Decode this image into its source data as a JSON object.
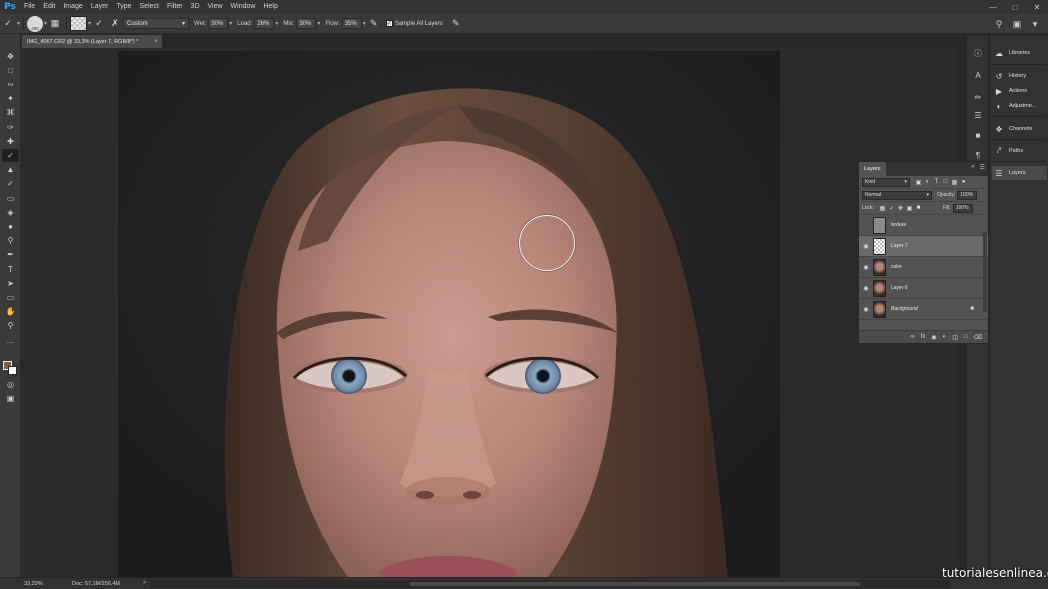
{
  "menubar": {
    "app_logo": "Ps",
    "items": [
      "File",
      "Edit",
      "Image",
      "Layer",
      "Type",
      "Select",
      "Filter",
      "3D",
      "View",
      "Window",
      "Help"
    ],
    "window_controls": [
      "minimize-icon",
      "maximize-icon",
      "close-icon"
    ]
  },
  "options": {
    "brush_size": "400",
    "preset_label": "Custom",
    "wet_label": "Wet:",
    "wet_value": "30%",
    "load_label": "Load:",
    "load_value": "26%",
    "mix_label": "Mix:",
    "mix_value": "30%",
    "flow_label": "Flow:",
    "flow_value": "35%",
    "sample_label": "Sample All Layers",
    "sample_checked": true
  },
  "document": {
    "tab_title": "IMG_4067.CR2 @ 33,3% (Layer 7, RGB/8*) *",
    "close_glyph": "×"
  },
  "tools": {
    "icons": [
      "move-tool-icon",
      "marquee-tool-icon",
      "lasso-tool-icon",
      "magic-wand-tool-icon",
      "crop-tool-icon",
      "eyedropper-tool-icon",
      "healing-brush-tool-icon",
      "mixer-brush-tool-icon",
      "clone-stamp-tool-icon",
      "history-brush-tool-icon",
      "eraser-tool-icon",
      "paint-bucket-tool-icon",
      "blur-tool-icon",
      "dodge-tool-icon",
      "pen-tool-icon",
      "type-tool-icon",
      "path-selection-tool-icon",
      "rectangle-tool-icon",
      "hand-tool-icon",
      "zoom-tool-icon",
      "more-tools-icon"
    ],
    "active": "mixer-brush-tool-icon",
    "foreground_color": "#8a5a50",
    "background_color": "#ffffff"
  },
  "dock": {
    "libraries": "Libraries",
    "history": "History",
    "actions": "Actions",
    "adjustments": "Adjustme...",
    "channels": "Channels",
    "paths": "Paths",
    "layers": "Layers"
  },
  "layers_panel": {
    "title": "Layers",
    "filter_kind": "Kind",
    "blend_mode": "Normal",
    "opacity_label": "Opacity:",
    "opacity_value": "100%",
    "lock_label": "Lock:",
    "fill_label": "Fill:",
    "fill_value": "100%",
    "layers": [
      {
        "name": "texture",
        "visible": false,
        "selected": false,
        "italic": false,
        "locked": false
      },
      {
        "name": "Layer 7",
        "visible": true,
        "selected": true,
        "italic": false,
        "locked": false
      },
      {
        "name": "color",
        "visible": true,
        "selected": false,
        "italic": false,
        "locked": false
      },
      {
        "name": "Layer 6",
        "visible": true,
        "selected": false,
        "italic": false,
        "locked": false
      },
      {
        "name": "Background",
        "visible": true,
        "selected": false,
        "italic": true,
        "locked": true
      }
    ]
  },
  "status": {
    "zoom": "33,33%",
    "doc_size": "Doc: 57,1M/256,4M",
    "arrow": ">"
  },
  "watermark": "tutorialesenlinea.es",
  "colors": {
    "app_bg": "#282828",
    "panel_bg": "#535353",
    "accent": "#31a8ff"
  }
}
